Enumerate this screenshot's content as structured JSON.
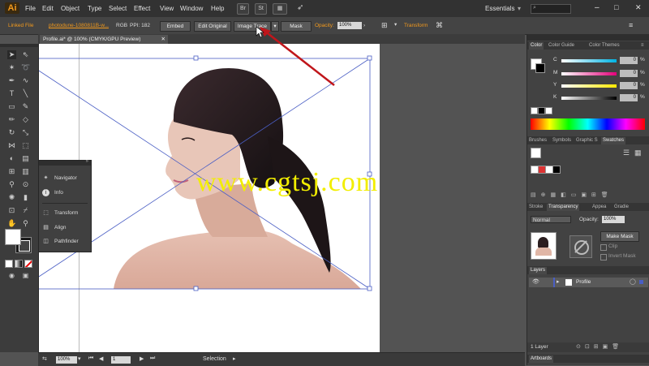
{
  "app": {
    "logo": "Ai"
  },
  "menu": [
    "File",
    "Edit",
    "Object",
    "Type",
    "Select",
    "Effect",
    "View",
    "Window",
    "Help"
  ],
  "menubar_buttons": {
    "br": "Br",
    "st": "St"
  },
  "workspace": "Essentials",
  "control_bar": {
    "linked_file": "Linked File",
    "filename": "photodune-1080811B-w...",
    "color_mode": "RGB",
    "ppi": "PPI: 182",
    "embed": "Embed",
    "edit_original": "Edit Original",
    "image_trace": "Image Trace",
    "mask": "Mask",
    "opacity_label": "Opacity:",
    "opacity_value": "100%",
    "transform": "Transform"
  },
  "doc_tab": {
    "title": "Profile.ai* @ 100% (CMYK/GPU Preview)"
  },
  "float_panel": {
    "items": [
      "Navigator",
      "Info",
      "Transform",
      "Align",
      "Pathfinder"
    ]
  },
  "color_panel": {
    "tabs": [
      "Color",
      "Color Guide",
      "Color Themes"
    ],
    "sliders": [
      {
        "label": "C",
        "value": "0",
        "color": "#00b3e3"
      },
      {
        "label": "M",
        "value": "0",
        "color": "#e3007a"
      },
      {
        "label": "Y",
        "value": "0",
        "color": "#ffe800"
      },
      {
        "label": "K",
        "value": "0",
        "color": "#000000"
      }
    ],
    "percent_sign": "%"
  },
  "swatches_panel": {
    "tabs": [
      "Brushes",
      "Symbols",
      "Graphic S",
      "Swatches"
    ]
  },
  "transparency_panel": {
    "tabs": [
      "Stroke",
      "Transparency",
      "Appea",
      "Gradie"
    ],
    "blend_mode": "Normal",
    "opacity_label": "Opacity:",
    "opacity_value": "100%",
    "make_mask": "Make Mask",
    "clip": "Clip",
    "invert_mask": "Invert Mask"
  },
  "layers_panel": {
    "title": "Layers",
    "layer_name": "Profile",
    "footer": "1 Layer"
  },
  "artboards_tab": "Artboards",
  "status_bar": {
    "zoom": "100%",
    "artboard_num": "1",
    "tool": "Selection"
  },
  "watermark": "www.cgtsj.com",
  "colors": {
    "accent": "#ff8c00",
    "arrow": "#c0161b",
    "watermark": "#f2ee00",
    "bbox": "#4a5ec4"
  }
}
